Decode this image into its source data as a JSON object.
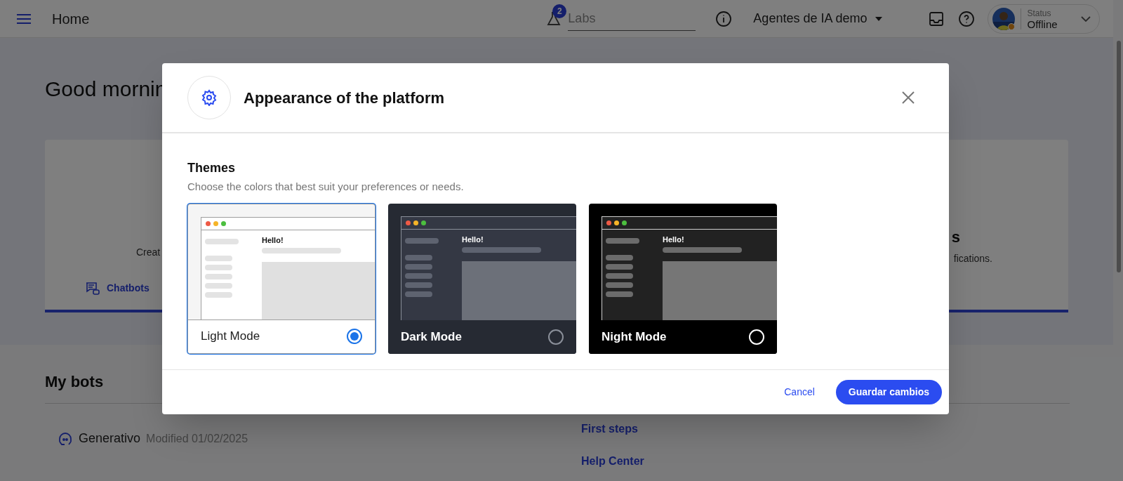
{
  "header": {
    "title": "Home",
    "labs": {
      "badge": "2",
      "placeholder": "Labs"
    },
    "workspace": "Agentes de IA demo",
    "status": {
      "label": "Status",
      "value": "Offline"
    }
  },
  "page": {
    "greeting": "Good mornin",
    "left_card": {
      "text": "Creat",
      "link": "Chatbots"
    },
    "right_card": {
      "title": "s",
      "text": "fications."
    },
    "my_bots": {
      "title": "My bots",
      "bots": [
        {
          "name": "Generativo",
          "modified": "Modified 01/02/2025"
        }
      ]
    },
    "links": [
      "First steps",
      "Help Center"
    ]
  },
  "dialog": {
    "title": "Appearance of the platform",
    "section_title": "Themes",
    "section_subtitle": "Choose the colors that best suit your preferences or needs.",
    "themes": [
      {
        "kind": "light",
        "label": "Light Mode",
        "preview_text": "Hello!",
        "selected": true
      },
      {
        "kind": "dark",
        "label": "Dark Mode",
        "preview_text": "Hello!",
        "selected": false
      },
      {
        "kind": "night",
        "label": "Night Mode",
        "preview_text": "Hello!",
        "selected": false
      }
    ],
    "cancel": "Cancel",
    "save": "Guardar cambios"
  }
}
